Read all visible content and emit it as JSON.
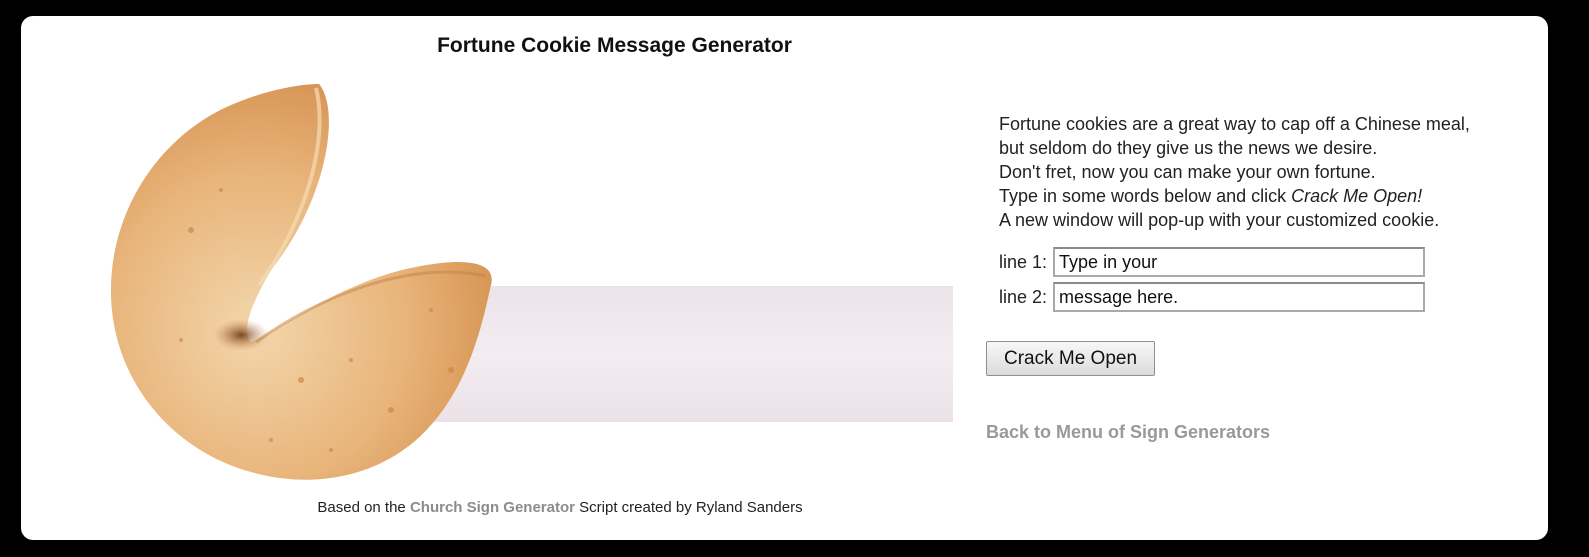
{
  "page": {
    "title": "Fortune Cookie Message Generator"
  },
  "intro": {
    "line1": "Fortune cookies are a great way to cap off a Chinese meal,",
    "line2": "but seldom do they give us the news we desire.",
    "line3": "Don't fret, now you can make your own fortune.",
    "line4_prefix": "Type in some words below and click ",
    "line4_emphasis": "Crack Me Open!",
    "line5": "A new window will pop-up with your customized cookie."
  },
  "form": {
    "line1_label": "line 1:",
    "line1_value": "Type in your",
    "line2_label": "line 2:",
    "line2_value": "message here.",
    "submit_label": "Crack Me Open"
  },
  "links": {
    "back_label": "Back to Menu of Sign Generators"
  },
  "footer": {
    "prefix": "Based on the ",
    "link_label": "Church Sign Generator",
    "suffix": " Script created by Ryland Sanders"
  },
  "colors": {
    "background": "#000000",
    "card": "#ffffff",
    "cookie": "#e2a86b",
    "paper_slip": "#f1e9ee",
    "link_gray": "#999999"
  }
}
